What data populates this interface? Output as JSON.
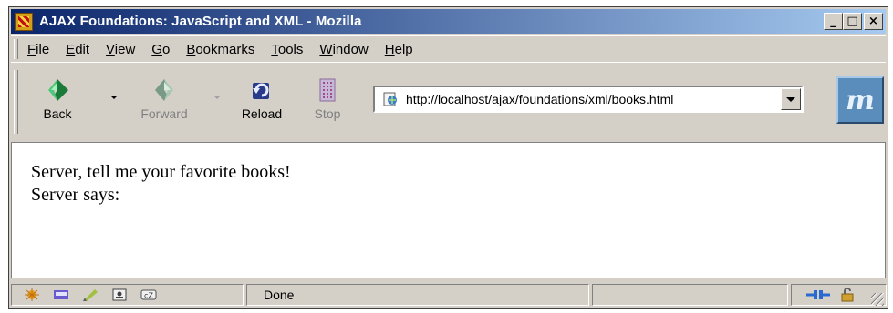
{
  "window": {
    "title": "AJAX Foundations: JavaScript and XML - Mozilla",
    "controls": {
      "minimize": "_",
      "maximize": "□",
      "close": "×"
    }
  },
  "menu": {
    "items": [
      {
        "label": "File",
        "underline": "F"
      },
      {
        "label": "Edit",
        "underline": "E"
      },
      {
        "label": "View",
        "underline": "V"
      },
      {
        "label": "Go",
        "underline": "G"
      },
      {
        "label": "Bookmarks",
        "underline": "B"
      },
      {
        "label": "Tools",
        "underline": "T"
      },
      {
        "label": "Window",
        "underline": "W"
      },
      {
        "label": "Help",
        "underline": "H"
      }
    ]
  },
  "toolbar": {
    "back": "Back",
    "forward": "Forward",
    "reload": "Reload",
    "stop": "Stop",
    "url": "http://localhost/ajax/foundations/xml/books.html",
    "brand": "m"
  },
  "page": {
    "line1": "Server, tell me your favorite books!",
    "line2": "Server says:"
  },
  "status": {
    "text": "Done"
  },
  "colors": {
    "titlebar_start": "#0a246a",
    "titlebar_end": "#a6caf0",
    "chrome": "#d4d0c8"
  }
}
